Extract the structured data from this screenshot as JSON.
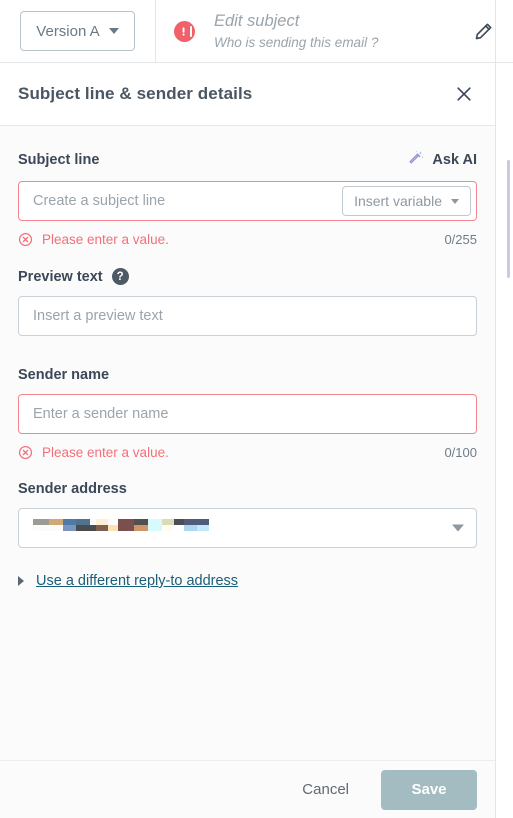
{
  "topbar": {
    "version_button": {
      "label": "Version A",
      "caret_icon": "chevron-down-icon"
    },
    "alert_icon": "alert-exclamation-icon",
    "subject_title": "Edit subject",
    "subject_subtitle": "Who is sending this email ?",
    "edit_icon": "pencil-icon",
    "alert_color": "#f2606a"
  },
  "panel": {
    "title": "Subject line & sender details",
    "close_icon": "close-icon"
  },
  "subject_line": {
    "label": "Subject line",
    "ask_ai_label": "Ask AI",
    "ask_ai_icon": "magic-wand-icon",
    "ask_ai_icon_color": "#8f93d6",
    "placeholder": "Create a subject line",
    "value": "",
    "insert_variable_label": "Insert variable",
    "insert_variable_caret": "chevron-down-icon",
    "error_message": "Please enter a value.",
    "error_icon": "error-circle-x-icon",
    "counter": "0/255",
    "error_color": "#f2707a"
  },
  "preview_text": {
    "label": "Preview text",
    "help_icon": "question-mark-icon",
    "placeholder": "Insert a preview text",
    "value": ""
  },
  "sender_name": {
    "label": "Sender name",
    "placeholder": "Enter a sender name",
    "value": "",
    "error_message": "Please enter a value.",
    "error_icon": "error-circle-x-icon",
    "counter": "0/100"
  },
  "sender_address": {
    "label": "Sender address",
    "value_redacted": true,
    "caret_icon": "chevron-down-icon",
    "redacted_blocks": [
      {
        "top": "#9b9b94",
        "bottom": "#fbfbfb"
      },
      {
        "top": "#cfa873",
        "bottom": "#fbfbfb"
      },
      {
        "top": "#4f79a8",
        "bottom": "#7996c2"
      },
      {
        "top": "#50738f",
        "bottom": "#4b4b4b"
      },
      {
        "top": "#fbfbfb",
        "bottom": "#4b4b4b"
      },
      {
        "top": "#fdf0d4",
        "bottom": "#7d6050"
      },
      {
        "top": "#fbfbfb",
        "bottom": "#fbe2b4"
      },
      {
        "top": "#7a4f4d",
        "bottom": "#7a4f4d"
      },
      {
        "top": "#50504f",
        "bottom": "#cf9467"
      },
      {
        "top": "#d6fafd",
        "bottom": "#d6fafd"
      },
      {
        "top": "#dcdcb4",
        "bottom": "#fdfdf4"
      },
      {
        "top": "#4b4f55",
        "bottom": "#ffffff"
      },
      {
        "top": "#4f5d7a",
        "bottom": "#aed6f2"
      },
      {
        "top": "#4f5d7a",
        "bottom": "#c2e8fb"
      }
    ]
  },
  "reply_to": {
    "label": "Use a different reply-to address",
    "chevron_icon": "chevron-right-icon",
    "link_color": "#1a5f7a"
  },
  "footer": {
    "cancel_label": "Cancel",
    "save_label": "Save",
    "save_disabled": true,
    "save_color": "#a3bcc2"
  }
}
